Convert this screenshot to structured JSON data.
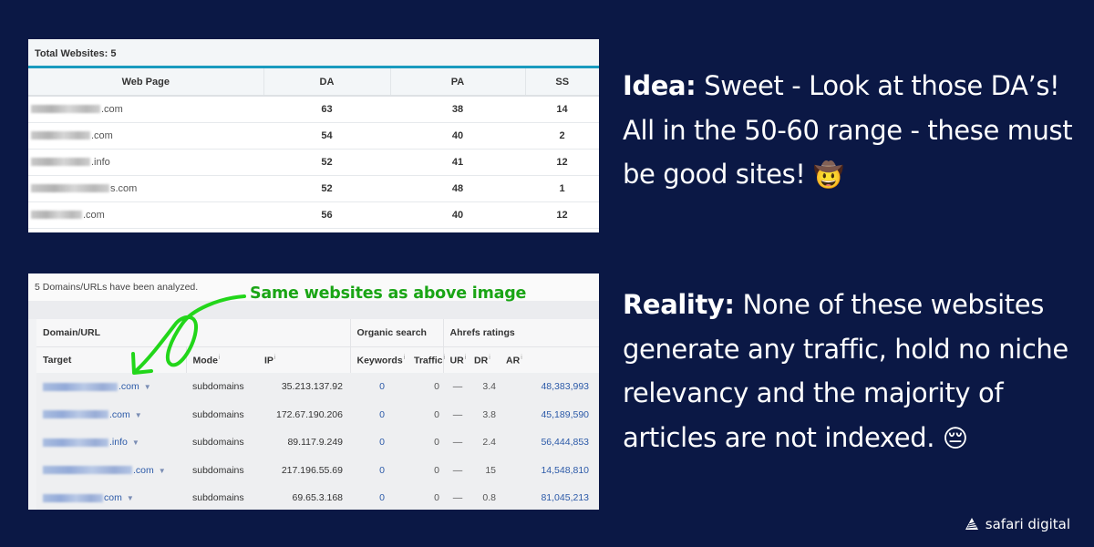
{
  "top_table": {
    "total_label": "Total Websites: 5",
    "columns": [
      "Web Page",
      "DA",
      "PA",
      "SS"
    ],
    "rows": [
      {
        "suffix": ".com",
        "da": "63",
        "pa": "38",
        "ss": "14"
      },
      {
        "suffix": ".com",
        "da": "54",
        "pa": "40",
        "ss": "2"
      },
      {
        "suffix": ".info",
        "da": "52",
        "pa": "41",
        "ss": "12"
      },
      {
        "suffix": "s.com",
        "da": "52",
        "pa": "48",
        "ss": "1"
      },
      {
        "suffix": ".com",
        "da": "56",
        "pa": "40",
        "ss": "12"
      }
    ]
  },
  "bottom_table": {
    "analyzed_label": "5 Domains/URLs have been analyzed.",
    "groups": [
      "Domain/URL",
      "Organic search",
      "Ahrefs ratings"
    ],
    "columns": [
      "Target",
      "Mode",
      "IP",
      "Keywords",
      "Traffic",
      "UR",
      "DR",
      "AR"
    ],
    "info_marker": "i",
    "rows": [
      {
        "suffix": ".com",
        "mode": "subdomains",
        "ip": "35.213.137.92",
        "keywords": "0",
        "traffic": "0",
        "ur": "—",
        "dr": "3.4",
        "ar": "48,383,993"
      },
      {
        "suffix": ".com",
        "mode": "subdomains",
        "ip": "172.67.190.206",
        "keywords": "0",
        "traffic": "0",
        "ur": "—",
        "dr": "3.8",
        "ar": "45,189,590"
      },
      {
        "suffix": ".info",
        "mode": "subdomains",
        "ip": "89.117.9.249",
        "keywords": "0",
        "traffic": "0",
        "ur": "—",
        "dr": "2.4",
        "ar": "56,444,853"
      },
      {
        "suffix": ".com",
        "mode": "subdomains",
        "ip": "217.196.55.69",
        "keywords": "0",
        "traffic": "0",
        "ur": "—",
        "dr": "15",
        "ar": "14,548,810"
      },
      {
        "suffix": "com",
        "mode": "subdomains",
        "ip": "69.65.3.168",
        "keywords": "0",
        "traffic": "0",
        "ur": "—",
        "dr": "0.8",
        "ar": "81,045,213"
      }
    ],
    "caret_icon": "▼"
  },
  "annotation": {
    "text": "Same websites as above image",
    "color": "#1aa515"
  },
  "idea": {
    "label": "Idea:",
    "text": " Sweet - Look at those DA’s! All in the 50-60 range - these must be good sites! ",
    "emoji": "🤠"
  },
  "reality": {
    "label": "Reality:",
    "text": " None of these websites generate any traffic, hold no niche relevancy and the majority of articles are not indexed. ",
    "emoji": "😔"
  },
  "brand": {
    "name": "safari digital"
  },
  "colors": {
    "background": "#0b1845",
    "link_blue": "#2c5aa8",
    "accent_teal": "#1a9bbf"
  }
}
